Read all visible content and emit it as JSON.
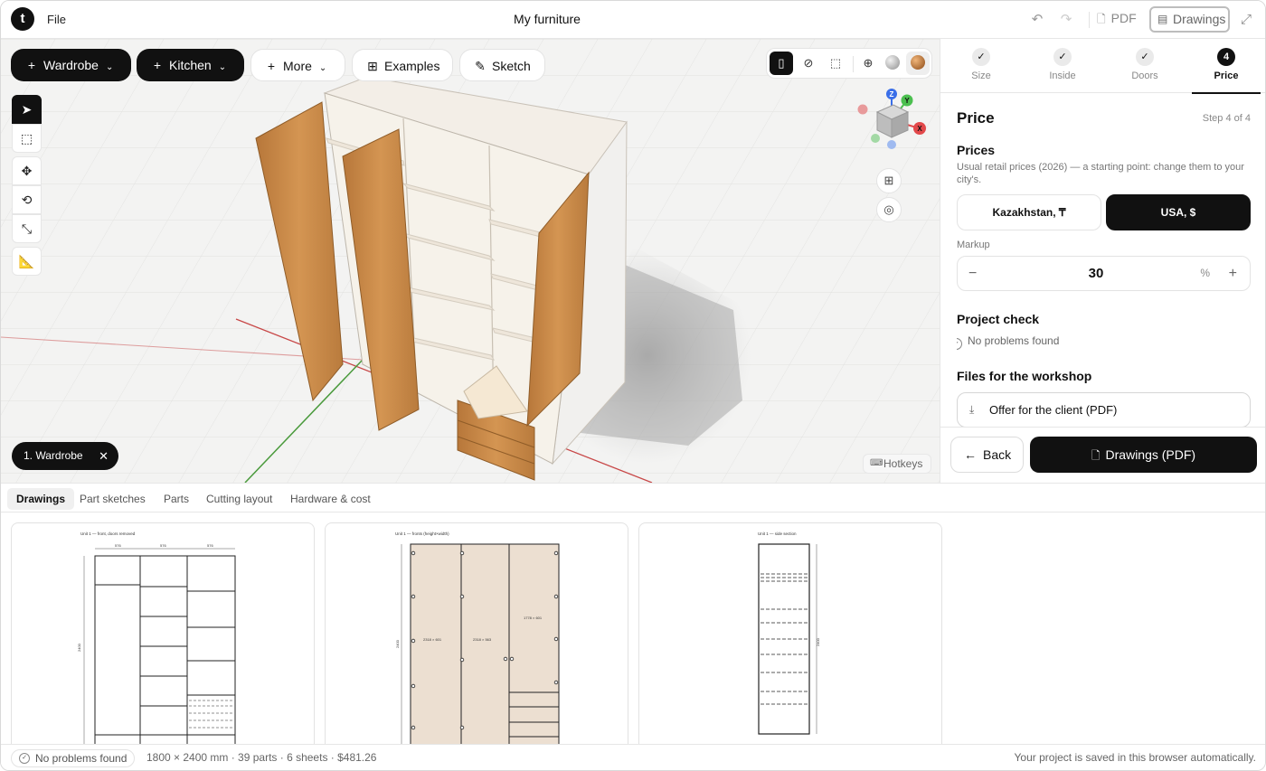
{
  "header": {
    "logo": "t",
    "file_menu": "File",
    "title": "My furniture",
    "pdf_label": "PDF",
    "drawings_label": "Drawings"
  },
  "toolbar": {
    "wardrobe": "Wardrobe",
    "kitchen": "Kitchen",
    "more": "More",
    "examples": "Examples",
    "sketch": "Sketch"
  },
  "axes": {
    "z": "Z",
    "y": "Y",
    "x": "X"
  },
  "viewport": {
    "unit_chip": "1. Wardrobe",
    "hotkeys": "Hotkeys"
  },
  "steps": [
    {
      "label": "Size",
      "status": "done"
    },
    {
      "label": "Inside",
      "status": "done"
    },
    {
      "label": "Doors",
      "status": "done"
    },
    {
      "label": "Price",
      "status": "current",
      "number": "4"
    }
  ],
  "panel": {
    "title": "Price",
    "step_indicator": "Step 4 of 4",
    "prices_title": "Prices",
    "prices_subtitle": "Usual retail prices (2026) — a starting point: change them to your city's.",
    "regions": [
      {
        "label": "Kazakhstan, ₸",
        "selected": false
      },
      {
        "label": "USA, $",
        "selected": true
      }
    ],
    "markup_label": "Markup",
    "markup_value": "30",
    "markup_unit": "%",
    "check_title": "Project check",
    "check_result": "No problems found",
    "files_title": "Files for the workshop",
    "file_offer": "Offer for the client (PDF)",
    "back_label": "Back",
    "drawings_pdf_label": "Drawings (PDF)"
  },
  "bottom_tabs": [
    {
      "label": "Drawings",
      "active": true
    },
    {
      "label": "Part sketches",
      "active": false
    },
    {
      "label": "Parts",
      "active": false
    },
    {
      "label": "Cutting layout",
      "active": false
    },
    {
      "label": "Hardware & cost",
      "active": false
    }
  ],
  "sheets": [
    {
      "title": "Unit 1 — front, doors removed",
      "dims": [
        "576",
        "576",
        "576",
        "2400"
      ]
    },
    {
      "title": "Unit 1 — fronts (height×width)",
      "dims": [
        "2318 × 601",
        "2318 × 563",
        "1778 × 601",
        "2400"
      ]
    },
    {
      "title": "Unit 1 — side section",
      "dims": [
        "2400"
      ]
    }
  ],
  "status": {
    "problems": "No problems found",
    "summary": "1800 × 2400 mm · 39 parts · 6 sheets · $481.26",
    "saved": "Your project is saved in this browser automatically."
  },
  "colors": {
    "accent": "#111111",
    "wood": "#c98a45",
    "axis_x": "#e2484a",
    "axis_y": "#4bbf4f",
    "axis_z": "#3a6ee8"
  }
}
